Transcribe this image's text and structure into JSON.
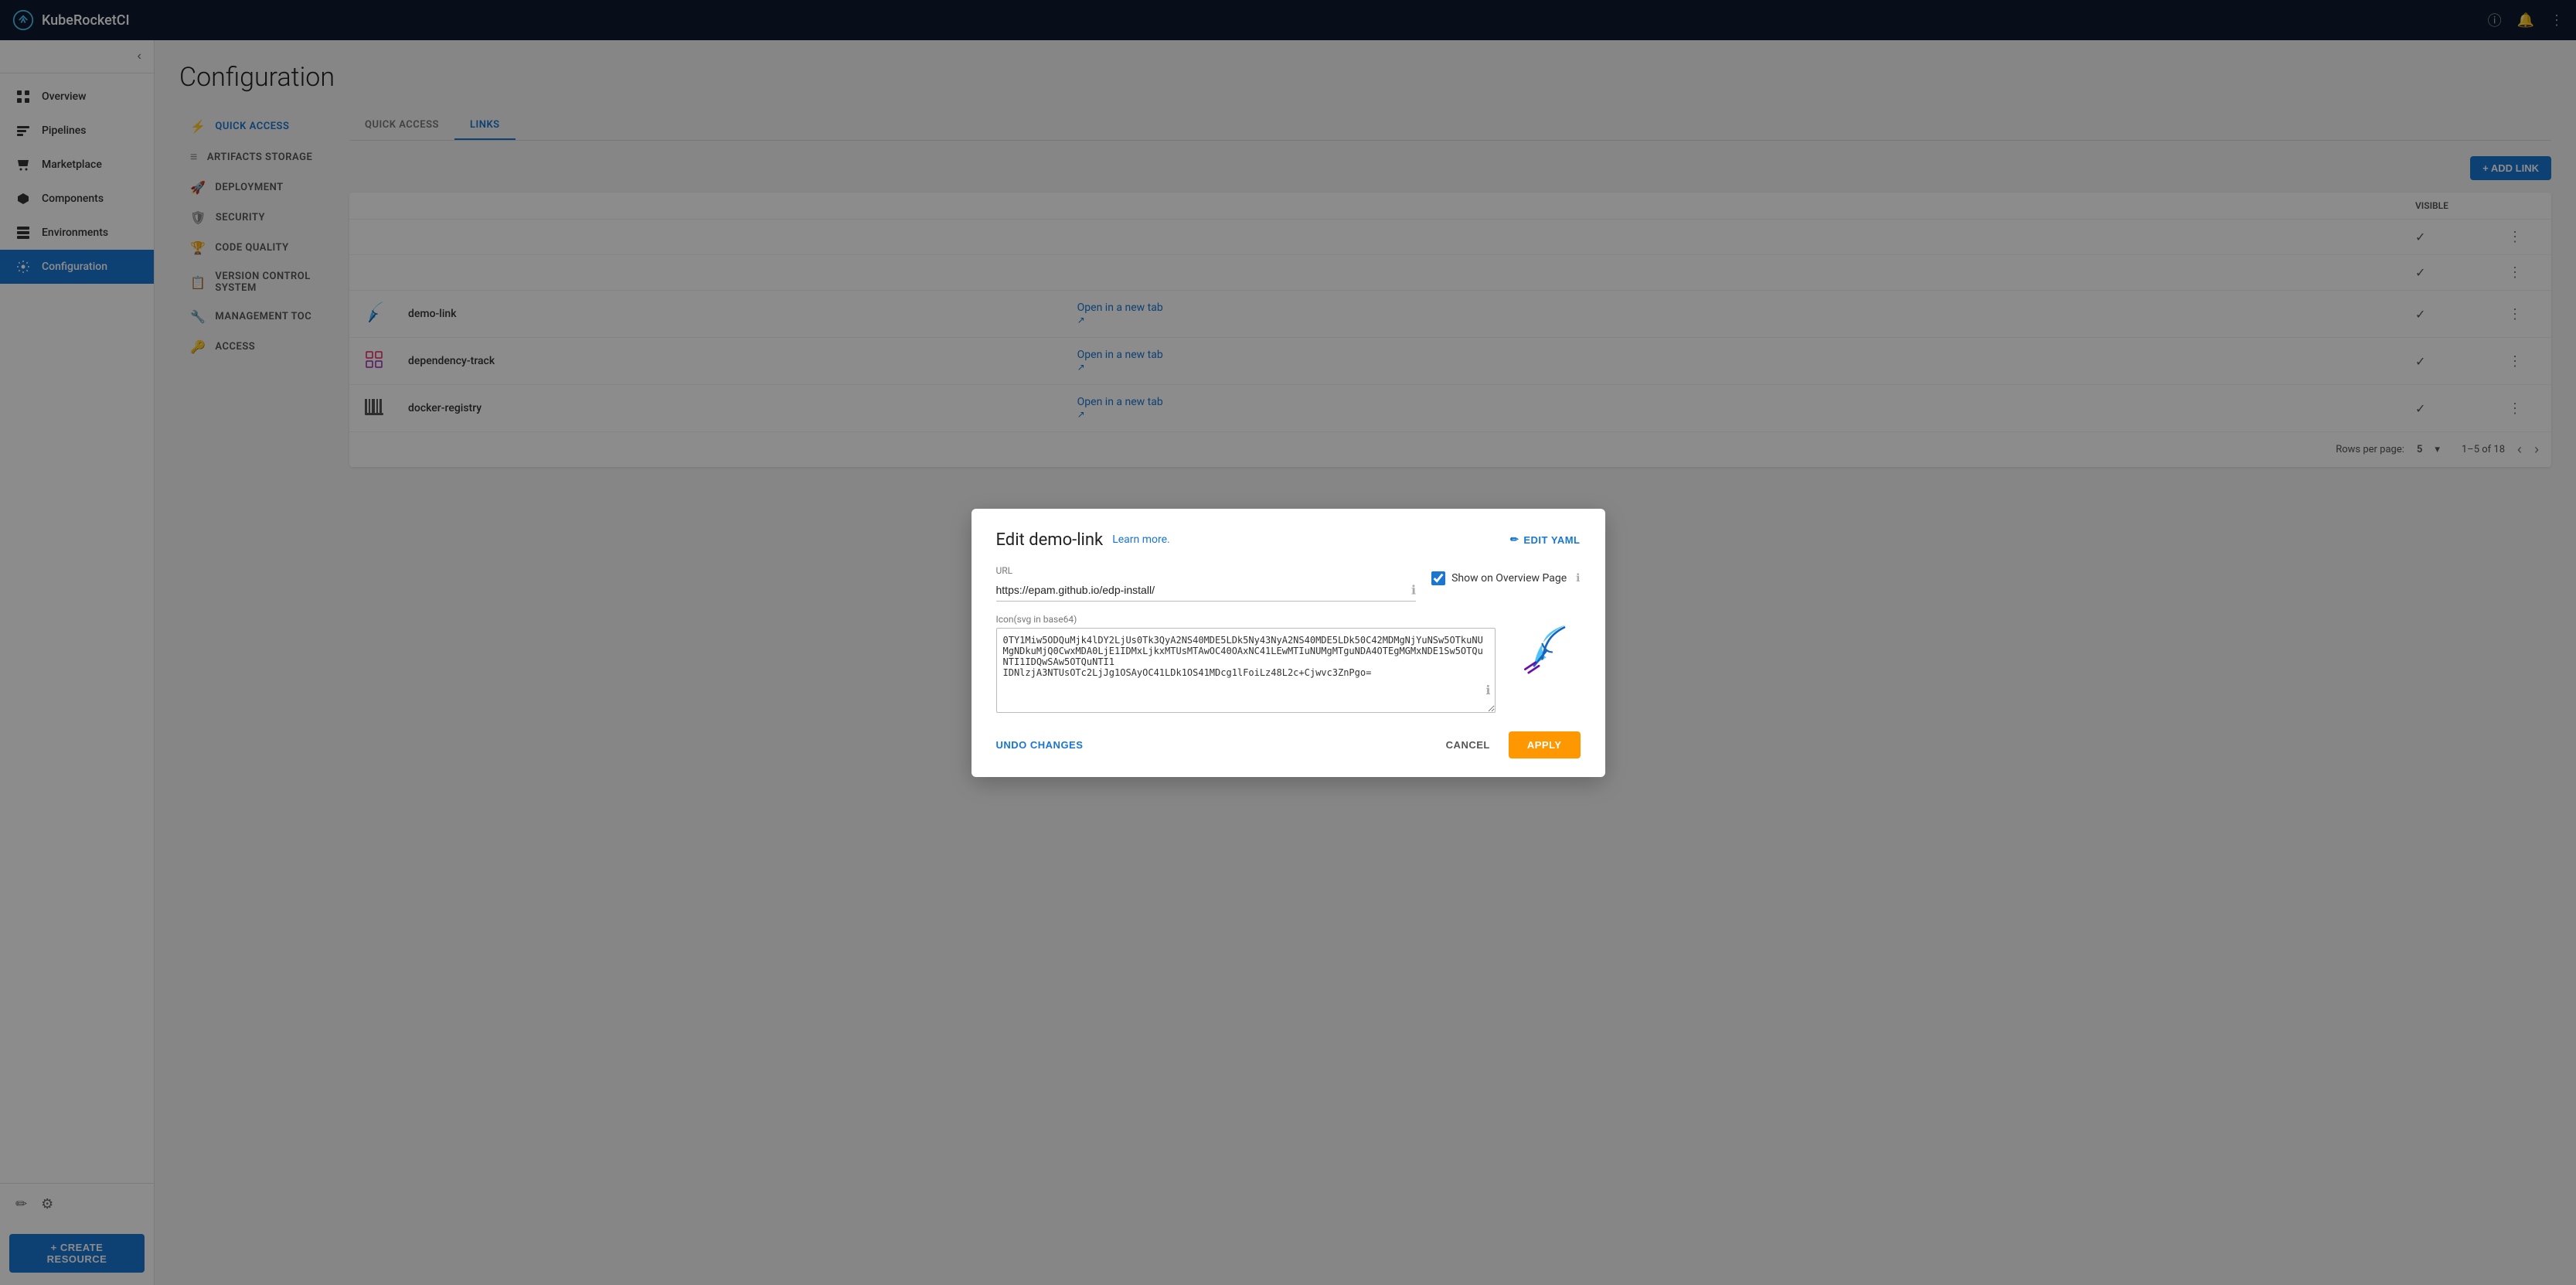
{
  "app": {
    "name": "KubeRocketCI"
  },
  "topbar": {
    "info_icon": "ⓘ",
    "bell_icon": "🔔",
    "more_icon": "⋮"
  },
  "sidebar": {
    "collapse_icon": "‹",
    "items": [
      {
        "label": "Overview",
        "icon": "grid",
        "active": false
      },
      {
        "label": "Pipelines",
        "icon": "bar-chart",
        "active": false
      },
      {
        "label": "Marketplace",
        "icon": "cart",
        "active": false
      },
      {
        "label": "Components",
        "icon": "diamond",
        "active": false
      },
      {
        "label": "Environments",
        "icon": "layers",
        "active": false
      },
      {
        "label": "Configuration",
        "icon": "gear",
        "active": true
      }
    ],
    "footer": {
      "edit_icon": "✏",
      "settings_icon": "⚙"
    },
    "create_resource_label": "+ CREATE RESOURCE"
  },
  "page": {
    "title": "Configuration"
  },
  "config_nav": {
    "items": [
      {
        "label": "QUICK ACCESS",
        "icon": "⚡",
        "active": true
      },
      {
        "label": "ARTIFACTS STORAGE",
        "icon": "≡"
      },
      {
        "label": "DEPLOYMENT",
        "icon": "🚀"
      },
      {
        "label": "SECURITY",
        "icon": "🛡"
      },
      {
        "label": "CODE QUALITY",
        "icon": "🏆"
      },
      {
        "label": "VERSION CONTROL SYSTEM",
        "icon": "📋"
      },
      {
        "label": "MANAGEMENT ToC",
        "icon": "🔧"
      },
      {
        "label": "ACCESS",
        "icon": "🔑"
      }
    ]
  },
  "tabs": {
    "items": [
      {
        "label": "QUICK ACCESS",
        "active": false
      },
      {
        "label": "LINKS",
        "active": true
      }
    ]
  },
  "links_table": {
    "add_button": "+ ADD LINK",
    "visible_header": "Visible",
    "rows": [
      {
        "icon": "✔",
        "name": "",
        "url_label": "",
        "url_href": "",
        "visible": true,
        "has_actions": true
      },
      {
        "icon": "✔",
        "name": "",
        "url_label": "",
        "url_href": "",
        "visible": true,
        "has_actions": true
      },
      {
        "icon_type": "feather",
        "name": "demo-link",
        "url_label": "Open in a new tab",
        "url_href": "#",
        "visible": true,
        "has_actions": true
      },
      {
        "icon_type": "grid",
        "name": "dependency-track",
        "url_label": "Open in a new tab",
        "url_href": "#",
        "visible": true,
        "has_actions": true
      },
      {
        "icon_type": "barcode",
        "name": "docker-registry",
        "url_label": "Open in a new tab",
        "url_href": "#",
        "visible": true,
        "has_actions": true
      }
    ],
    "pagination": {
      "rows_per_page": "Rows per page:",
      "rows_count": "5",
      "page_info": "1–5 of 18",
      "prev_icon": "‹",
      "next_icon": "›"
    }
  },
  "modal": {
    "title": "Edit demo-link",
    "learn_more": "Learn more.",
    "edit_yaml_label": "EDIT YAML",
    "url_label": "URL",
    "url_value": "https://epam.github.io/edp-install/",
    "show_on_overview_label": "Show on Overview Page",
    "show_on_overview_checked": true,
    "icon_label": "Icon(svg in base64)",
    "icon_value": "0TY1Miw5ODQuMjk4lDY2LjUs0Tk3QyA2NS40MDE5LDk5Ny43NyA2NS40MDE5LDk50C42MDMgNjYuNSw5OTkuNUMgNDkuMjQ0CwxMDA0LjE1IDMxLjkxMTUsMTAwOC40OAxNC41LEwMTIuNUMgMTguNDA4OTEgMGMxNDE1Sw5OTQuNTI1IDQwSAw5OTQuNTI1 IDNlzjA3NTUsOTc2LjJg1OSAyOC41LDk1OS41MDcg1lFoiLz48L2c+Cjwvc3ZnPgo=",
    "undo_label": "UNDO CHANGES",
    "cancel_label": "CANCEL",
    "apply_label": "APPLY"
  }
}
